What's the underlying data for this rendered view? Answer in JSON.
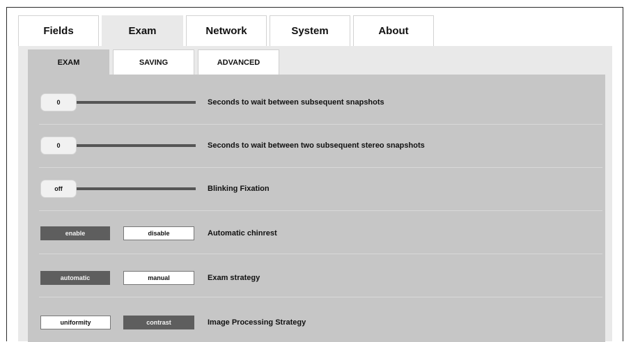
{
  "top_tabs": [
    {
      "label": "Fields",
      "active": false
    },
    {
      "label": "Exam",
      "active": true
    },
    {
      "label": "Network",
      "active": false
    },
    {
      "label": "System",
      "active": false
    },
    {
      "label": "About",
      "active": false
    }
  ],
  "sub_tabs": [
    {
      "label": "EXAM",
      "active": true
    },
    {
      "label": "SAVING",
      "active": false
    },
    {
      "label": "ADVANCED",
      "active": false
    }
  ],
  "settings": {
    "snapshot_wait": {
      "value": "0",
      "label": "Seconds to wait between subsequent snapshots"
    },
    "stereo_wait": {
      "value": "0",
      "label": "Seconds to wait between two subsequent stereo snapshots"
    },
    "blinking": {
      "value": "off",
      "label": "Blinking Fixation"
    },
    "chinrest": {
      "options": [
        "enable",
        "disable"
      ],
      "selected": "enable",
      "label": "Automatic chinrest"
    },
    "exam_strategy": {
      "options": [
        "automatic",
        "manual"
      ],
      "selected": "automatic",
      "label": "Exam strategy"
    },
    "image_processing": {
      "options": [
        "uniformity",
        "contrast"
      ],
      "selected": "contrast",
      "label": "Image Processing Strategy"
    }
  },
  "colors": {
    "panel_bg": "#e9e9e9",
    "content_bg": "#c6c6c6",
    "selected_button": "#5e5e5e"
  }
}
